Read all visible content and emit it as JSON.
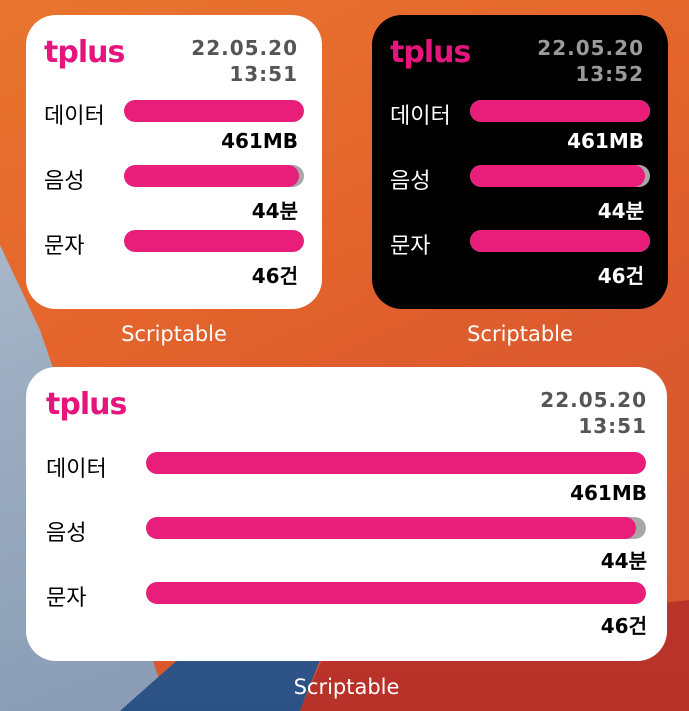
{
  "brand_color": "#e91e7b",
  "caption": "Scriptable",
  "widgets": [
    {
      "theme": "light",
      "logo": "tplus",
      "date": "22.05.20",
      "time": "13:51",
      "rows": [
        {
          "label": "데이터",
          "value": "461MB",
          "level": 1.0
        },
        {
          "label": "음성",
          "value": "44분",
          "level": 0.97
        },
        {
          "label": "문자",
          "value": "46건",
          "level": 1.0
        }
      ]
    },
    {
      "theme": "dark",
      "logo": "tplus",
      "date": "22.05.20",
      "time": "13:52",
      "rows": [
        {
          "label": "데이터",
          "value": "461MB",
          "level": 1.0
        },
        {
          "label": "음성",
          "value": "44분",
          "level": 0.97
        },
        {
          "label": "문자",
          "value": "46건",
          "level": 1.0
        }
      ]
    },
    {
      "theme": "light",
      "logo": "tplus",
      "date": "22.05.20",
      "time": "13:51",
      "rows": [
        {
          "label": "데이터",
          "value": "461MB",
          "level": 1.0
        },
        {
          "label": "음성",
          "value": "44분",
          "level": 0.98
        },
        {
          "label": "문자",
          "value": "46건",
          "level": 1.0
        }
      ]
    }
  ]
}
